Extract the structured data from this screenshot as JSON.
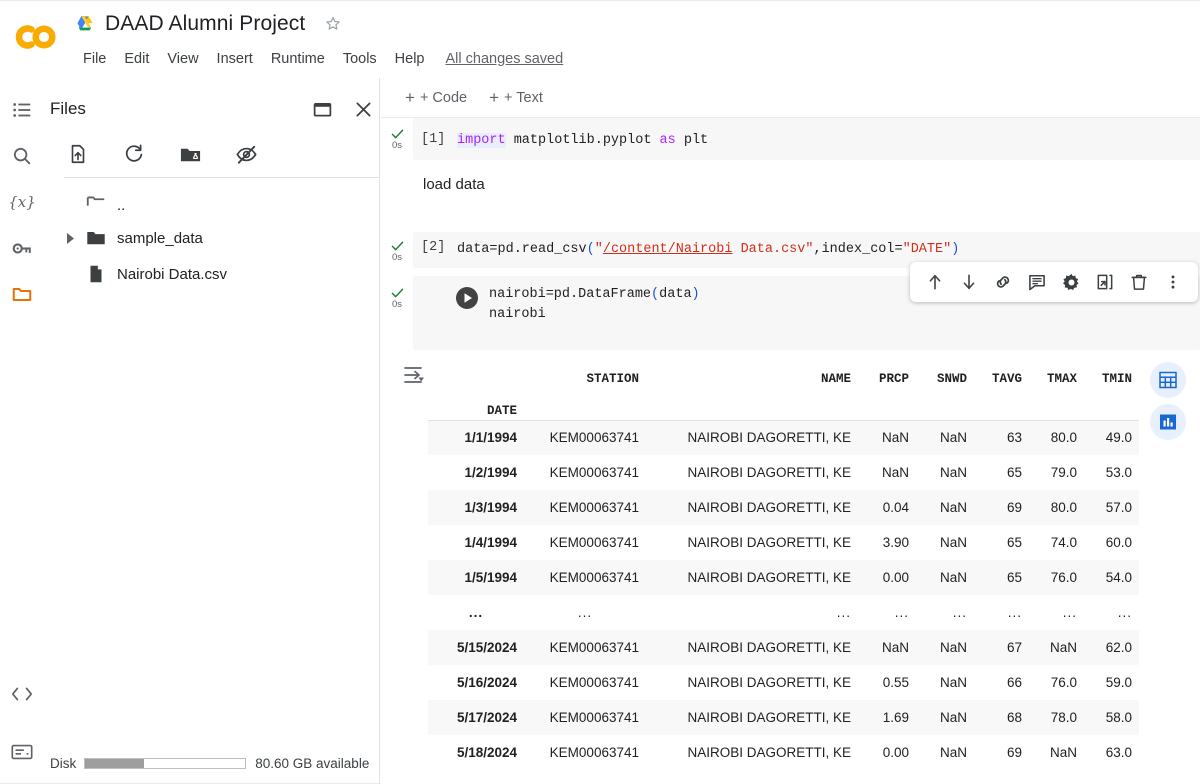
{
  "app": {
    "logo": "colab-logo",
    "drive_icon": "google-drive-icon",
    "doc_title": "DAAD Alumni Project",
    "star_icon": "star-outline-icon",
    "save_status": "All changes saved",
    "menu": [
      "File",
      "Edit",
      "View",
      "Insert",
      "Runtime",
      "Tools",
      "Help"
    ]
  },
  "rail": {
    "items": [
      {
        "name": "table-of-contents-icon",
        "label": "Table of contents"
      },
      {
        "name": "search-icon",
        "label": "Find and replace"
      },
      {
        "name": "variables-icon",
        "label": "Variables"
      },
      {
        "name": "secrets-key-icon",
        "label": "Secrets"
      },
      {
        "name": "files-folder-icon",
        "label": "Files"
      }
    ],
    "active_index": 4
  },
  "files_panel": {
    "title": "Files",
    "header_buttons": [
      {
        "name": "open-in-new-pane-icon",
        "label": "Move panel"
      },
      {
        "name": "close-icon",
        "label": "Close"
      }
    ],
    "toolbar": [
      {
        "name": "upload-file-icon",
        "label": "Upload to session storage"
      },
      {
        "name": "refresh-icon",
        "label": "Refresh"
      },
      {
        "name": "mount-drive-icon",
        "label": "Mount Drive"
      },
      {
        "name": "hide-hidden-files-icon",
        "label": "Show/hide hidden files"
      }
    ],
    "tree": [
      {
        "name": "parent-dir",
        "label": "..",
        "icon": "folder-up-icon",
        "expandable": false
      },
      {
        "name": "sample_data",
        "label": "sample_data",
        "icon": "folder-icon",
        "expandable": true
      },
      {
        "name": "nairobi-data-csv",
        "label": "Nairobi Data.csv",
        "icon": "file-icon",
        "expandable": false
      }
    ]
  },
  "status_bar": {
    "disk_label": "Disk",
    "disk_available": "80.60 GB available",
    "disk_used_percent": 37
  },
  "notebook": {
    "toolbar": {
      "add_code": "+ Code",
      "add_text": "+ Text"
    },
    "cells": [
      {
        "type": "code",
        "exec_count": "[1]",
        "runtime": "0s",
        "status": "done",
        "lines": [
          "import matplotlib.pyplot as plt"
        ]
      },
      {
        "type": "text",
        "content": "load data"
      },
      {
        "type": "code",
        "exec_count": "[2]",
        "runtime": "0s",
        "status": "done",
        "lines": [
          "data=pd.read_csv(\"/content/Nairobi Data.csv\",index_col=\"DATE\")"
        ]
      },
      {
        "type": "code",
        "exec_count": "",
        "runtime": "0s",
        "status": "done",
        "lines": [
          "nairobi=pd.DataFrame(data)",
          "nairobi"
        ]
      }
    ],
    "cell_toolbar": [
      {
        "name": "move-cell-up-icon",
        "label": "Move cell up"
      },
      {
        "name": "move-cell-down-icon",
        "label": "Move cell down"
      },
      {
        "name": "copy-link-to-cell-icon",
        "label": "Link to cell"
      },
      {
        "name": "add-comment-icon",
        "label": "Add a comment"
      },
      {
        "name": "cell-settings-gear-icon",
        "label": "Editor settings"
      },
      {
        "name": "mirror-cell-in-tab-icon",
        "label": "Mirror cell in tab"
      },
      {
        "name": "delete-cell-icon",
        "label": "Delete cell"
      },
      {
        "name": "more-cell-actions-icon",
        "label": "More cell actions"
      }
    ]
  },
  "dataframe": {
    "sort_icon": "dataframe-filter-icon",
    "side_buttons": [
      {
        "name": "interactive-table-icon",
        "label": "Generate interactive table"
      },
      {
        "name": "suggest-charts-icon",
        "label": "Suggest charts"
      }
    ],
    "index_name": "DATE",
    "columns": [
      "STATION",
      "NAME",
      "PRCP",
      "SNWD",
      "TAVG",
      "TMAX",
      "TMIN"
    ],
    "rows": [
      {
        "index": "1/1/1994",
        "cells": [
          "KEM00063741",
          "NAIROBI DAGORETTI, KE",
          "NaN",
          "NaN",
          "63",
          "80.0",
          "49.0"
        ]
      },
      {
        "index": "1/2/1994",
        "cells": [
          "KEM00063741",
          "NAIROBI DAGORETTI, KE",
          "NaN",
          "NaN",
          "65",
          "79.0",
          "53.0"
        ]
      },
      {
        "index": "1/3/1994",
        "cells": [
          "KEM00063741",
          "NAIROBI DAGORETTI, KE",
          "0.04",
          "NaN",
          "69",
          "80.0",
          "57.0"
        ]
      },
      {
        "index": "1/4/1994",
        "cells": [
          "KEM00063741",
          "NAIROBI DAGORETTI, KE",
          "3.90",
          "NaN",
          "65",
          "74.0",
          "60.0"
        ]
      },
      {
        "index": "1/5/1994",
        "cells": [
          "KEM00063741",
          "NAIROBI DAGORETTI, KE",
          "0.00",
          "NaN",
          "65",
          "76.0",
          "54.0"
        ]
      },
      {
        "index": "...",
        "cells": [
          "...",
          "...",
          "...",
          "...",
          "...",
          "...",
          "..."
        ]
      },
      {
        "index": "5/15/2024",
        "cells": [
          "KEM00063741",
          "NAIROBI DAGORETTI, KE",
          "NaN",
          "NaN",
          "67",
          "NaN",
          "62.0"
        ]
      },
      {
        "index": "5/16/2024",
        "cells": [
          "KEM00063741",
          "NAIROBI DAGORETTI, KE",
          "0.55",
          "NaN",
          "66",
          "76.0",
          "59.0"
        ]
      },
      {
        "index": "5/17/2024",
        "cells": [
          "KEM00063741",
          "NAIROBI DAGORETTI, KE",
          "1.69",
          "NaN",
          "68",
          "78.0",
          "58.0"
        ]
      },
      {
        "index": "5/18/2024",
        "cells": [
          "KEM00063741",
          "NAIROBI DAGORETTI, KE",
          "0.00",
          "NaN",
          "69",
          "NaN",
          "63.0"
        ]
      }
    ]
  },
  "colors": {
    "colab_orange": "#F9AB00",
    "accent_blue": "#1967D2",
    "keyword_purple": "#AA22FF",
    "string_red": "#D12F1B",
    "paren_blue": "#1A4FD6",
    "success_green": "#188038",
    "code_bg": "#F7F7F7"
  }
}
